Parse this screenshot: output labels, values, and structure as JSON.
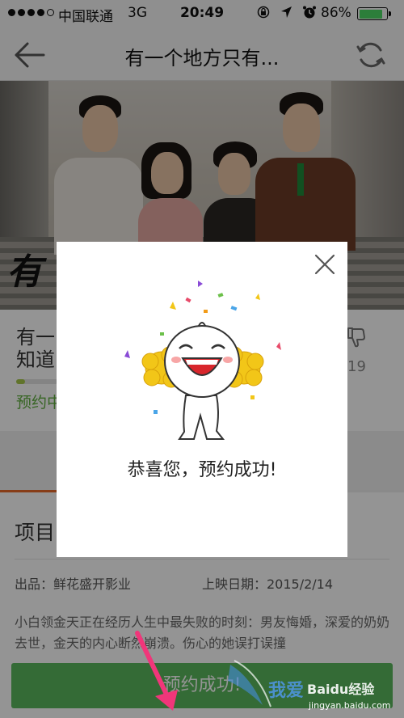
{
  "status_bar": {
    "carrier": "中国联通",
    "network": "3G",
    "time": "20:49",
    "battery_percent": "86%",
    "battery_level": 0.86,
    "icons": [
      "orientation-lock-icon",
      "location-arrow-icon",
      "alarm-icon"
    ]
  },
  "nav": {
    "title": "有一个地方只有...",
    "back_icon": "back-arrow-icon",
    "refresh_icon": "refresh-icon"
  },
  "poster": {
    "title_fragment": "有"
  },
  "movie": {
    "name_line1": "有一",
    "name_line2": "知道",
    "reserve_status": "预约中",
    "dislike_count": "19",
    "progress": 0.22
  },
  "detail": {
    "section_title": "项目",
    "producer": "出品：鲜花盛开影业",
    "release_date": "上映日期：2015/2/14",
    "description": "小白领金天正在经历人生中最失败的时刻：男友悔婚，深爱的奶奶去世，金天的内心断然崩溃。伤心的她误打误撞"
  },
  "bottom_button": {
    "label": "预约成功!"
  },
  "dialog": {
    "message": "恭喜您，预约成功!",
    "close_icon": "close-icon"
  },
  "watermark": {
    "text1": "我爱",
    "text2": "Baidu经验",
    "url": "jingyan.baidu.com"
  },
  "colors": {
    "accent_green": "#5bb85d",
    "status_green": "#5fae3f",
    "tab_orange": "#e8692a",
    "arrow_pink": "#f0367a"
  }
}
